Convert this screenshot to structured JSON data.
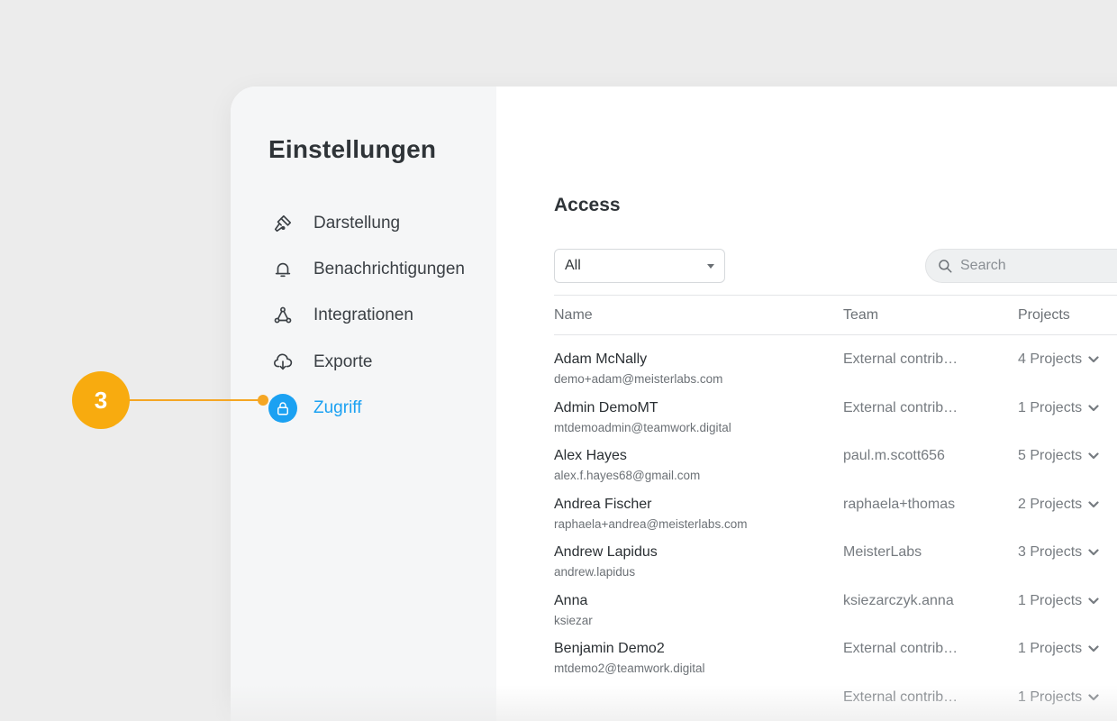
{
  "sidebar": {
    "title": "Einstellungen",
    "items": [
      {
        "label": "Darstellung",
        "icon": "paint-brush-icon",
        "active": false
      },
      {
        "label": "Benachrichtigungen",
        "icon": "bell-icon",
        "active": false
      },
      {
        "label": "Integrationen",
        "icon": "integration-nodes-icon",
        "active": false
      },
      {
        "label": "Exporte",
        "icon": "cloud-download-icon",
        "active": false
      },
      {
        "label": "Zugriff",
        "icon": "lock-icon",
        "active": true
      }
    ]
  },
  "main": {
    "title": "Access",
    "filter": {
      "selected": "All"
    },
    "search": {
      "placeholder": "Search"
    },
    "table": {
      "columns": [
        "Name",
        "Team",
        "Projects"
      ],
      "rows": [
        {
          "name": "Adam McNally",
          "email": "demo+adam@meisterlabs.com",
          "team": "External contrib…",
          "projects": "4 Projects"
        },
        {
          "name": "Admin DemoMT",
          "email": "mtdemoadmin@teamwork.digital",
          "team": "External contrib…",
          "projects": "1 Projects"
        },
        {
          "name": "Alex Hayes",
          "email": "alex.f.hayes68@gmail.com",
          "team": "paul.m.scott656",
          "projects": "5 Projects"
        },
        {
          "name": "Andrea Fischer",
          "email": "raphaela+andrea@meisterlabs.com",
          "team": "raphaela+thomas",
          "projects": "2 Projects"
        },
        {
          "name": "Andrew Lapidus",
          "email": "andrew.lapidus",
          "team": "MeisterLabs",
          "projects": "3 Projects"
        },
        {
          "name": "Anna",
          "email": "ksiezar",
          "team": "ksiezarczyk.anna",
          "projects": "1 Projects"
        },
        {
          "name": "Benjamin Demo2",
          "email": "mtdemo2@teamwork.digital",
          "team": "External contrib…",
          "projects": "1 Projects"
        },
        {
          "name": "",
          "email": "",
          "team": "External contrib…",
          "projects": "1 Projects"
        }
      ]
    }
  },
  "callout": {
    "number": "3"
  },
  "colors": {
    "accent": "#1ba1f2",
    "callout": "#f8ab0f",
    "sidebar_bg": "#f5f6f7",
    "page_bg": "#ececec"
  }
}
